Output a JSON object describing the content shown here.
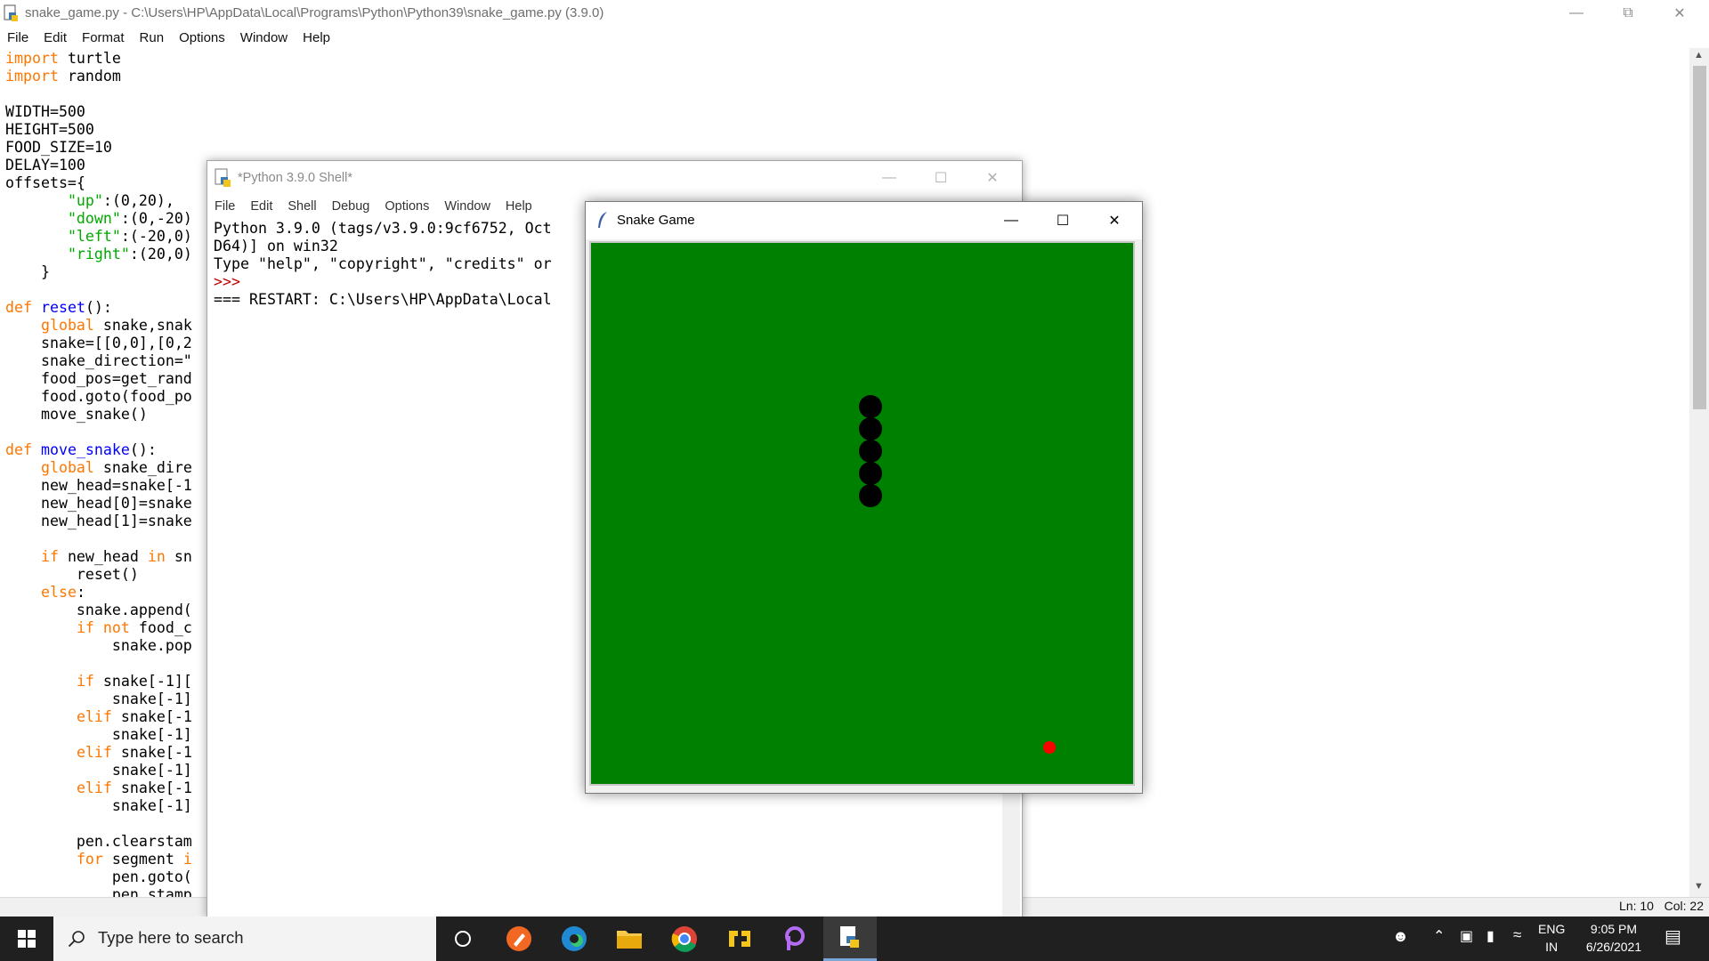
{
  "editor": {
    "title": "snake_game.py - C:\\Users\\HP\\AppData\\Local\\Programs\\Python\\Python39\\snake_game.py (3.9.0)",
    "menu": [
      "File",
      "Edit",
      "Format",
      "Run",
      "Options",
      "Window",
      "Help"
    ],
    "status": "Ln: 10   Col: 22",
    "code": [
      [
        [
          "kw",
          "import"
        ],
        [
          "t",
          " turtle"
        ]
      ],
      [
        [
          "kw",
          "import"
        ],
        [
          "t",
          " random"
        ]
      ],
      [],
      [
        [
          "t",
          "WIDTH=500"
        ]
      ],
      [
        [
          "t",
          "HEIGHT=500"
        ]
      ],
      [
        [
          "t",
          "FOOD_SIZE=10"
        ]
      ],
      [
        [
          "t",
          "DELAY=100"
        ]
      ],
      [
        [
          "t",
          "offsets={"
        ]
      ],
      [
        [
          "t",
          "       "
        ],
        [
          "str",
          "\"up\""
        ],
        [
          "t",
          ":(0,20),"
        ]
      ],
      [
        [
          "t",
          "       "
        ],
        [
          "str",
          "\"down\""
        ],
        [
          "t",
          ":(0,-20)"
        ]
      ],
      [
        [
          "t",
          "       "
        ],
        [
          "str",
          "\"left\""
        ],
        [
          "t",
          ":(-20,0)"
        ]
      ],
      [
        [
          "t",
          "       "
        ],
        [
          "str",
          "\"right\""
        ],
        [
          "t",
          ":(20,0)"
        ]
      ],
      [
        [
          "t",
          "    }"
        ]
      ],
      [],
      [
        [
          "kw",
          "def"
        ],
        [
          "t",
          " "
        ],
        [
          "def",
          "reset"
        ],
        [
          "t",
          "():"
        ]
      ],
      [
        [
          "t",
          "    "
        ],
        [
          "kw",
          "global"
        ],
        [
          "t",
          " snake,snak"
        ]
      ],
      [
        [
          "t",
          "    snake=[[0,0],[0,2"
        ]
      ],
      [
        [
          "t",
          "    snake_direction=\""
        ]
      ],
      [
        [
          "t",
          "    food_pos=get_rand"
        ]
      ],
      [
        [
          "t",
          "    food.goto(food_po"
        ]
      ],
      [
        [
          "t",
          "    move_snake()"
        ]
      ],
      [],
      [
        [
          "kw",
          "def"
        ],
        [
          "t",
          " "
        ],
        [
          "def",
          "move_snake"
        ],
        [
          "t",
          "():"
        ]
      ],
      [
        [
          "t",
          "    "
        ],
        [
          "kw",
          "global"
        ],
        [
          "t",
          " snake_dire"
        ]
      ],
      [
        [
          "t",
          "    new_head=snake[-1"
        ]
      ],
      [
        [
          "t",
          "    new_head[0]=snake"
        ]
      ],
      [
        [
          "t",
          "    new_head[1]=snake"
        ]
      ],
      [],
      [
        [
          "t",
          "    "
        ],
        [
          "kw",
          "if"
        ],
        [
          "t",
          " new_head "
        ],
        [
          "kw",
          "in"
        ],
        [
          "t",
          " sn"
        ]
      ],
      [
        [
          "t",
          "        reset()"
        ]
      ],
      [
        [
          "t",
          "    "
        ],
        [
          "kw",
          "else"
        ],
        [
          "t",
          ":"
        ]
      ],
      [
        [
          "t",
          "        snake.append("
        ]
      ],
      [
        [
          "t",
          "        "
        ],
        [
          "kw",
          "if not"
        ],
        [
          "t",
          " food_c"
        ]
      ],
      [
        [
          "t",
          "            snake.pop"
        ]
      ],
      [],
      [
        [
          "t",
          "        "
        ],
        [
          "kw",
          "if"
        ],
        [
          "t",
          " snake[-1]["
        ]
      ],
      [
        [
          "t",
          "            snake[-1]"
        ]
      ],
      [
        [
          "t",
          "        "
        ],
        [
          "kw",
          "elif"
        ],
        [
          "t",
          " snake[-1"
        ]
      ],
      [
        [
          "t",
          "            snake[-1]"
        ]
      ],
      [
        [
          "t",
          "        "
        ],
        [
          "kw",
          "elif"
        ],
        [
          "t",
          " snake[-1"
        ]
      ],
      [
        [
          "t",
          "            snake[-1]"
        ]
      ],
      [
        [
          "t",
          "        "
        ],
        [
          "kw",
          "elif"
        ],
        [
          "t",
          " snake[-1"
        ]
      ],
      [
        [
          "t",
          "            snake[-1]"
        ]
      ],
      [],
      [
        [
          "t",
          "        pen.clearstam"
        ]
      ],
      [
        [
          "t",
          "        "
        ],
        [
          "kw",
          "for"
        ],
        [
          "t",
          " segment "
        ],
        [
          "kw",
          "i"
        ]
      ],
      [
        [
          "t",
          "            pen.goto("
        ]
      ],
      [
        [
          "t",
          "            pen.stamp"
        ]
      ]
    ]
  },
  "shell": {
    "title": "*Python 3.9.0 Shell*",
    "menu": [
      "File",
      "Edit",
      "Shell",
      "Debug",
      "Options",
      "Window",
      "Help"
    ],
    "lines": [
      [
        [
          "t",
          "Python 3.9.0 (tags/v3.9.0:9cf6752, Oct"
        ]
      ],
      [
        [
          "t",
          "D64)] on win32"
        ]
      ],
      [
        [
          "t",
          "Type \"help\", \"copyright\", \"credits\" or"
        ]
      ],
      [
        [
          "prompt",
          ">>>"
        ]
      ],
      [
        [
          "t",
          "=== RESTART: C:\\Users\\HP\\AppData\\Local"
        ]
      ]
    ]
  },
  "game": {
    "title": "Snake Game",
    "background_color": "#008000",
    "snake_color": "#000000",
    "food_color": "#ff0000",
    "snake_segments": 5
  },
  "taskbar": {
    "search_placeholder": "Type here to search",
    "language": "ENG",
    "region": "IN",
    "time": "9:05 PM",
    "date": "6/26/2021"
  }
}
